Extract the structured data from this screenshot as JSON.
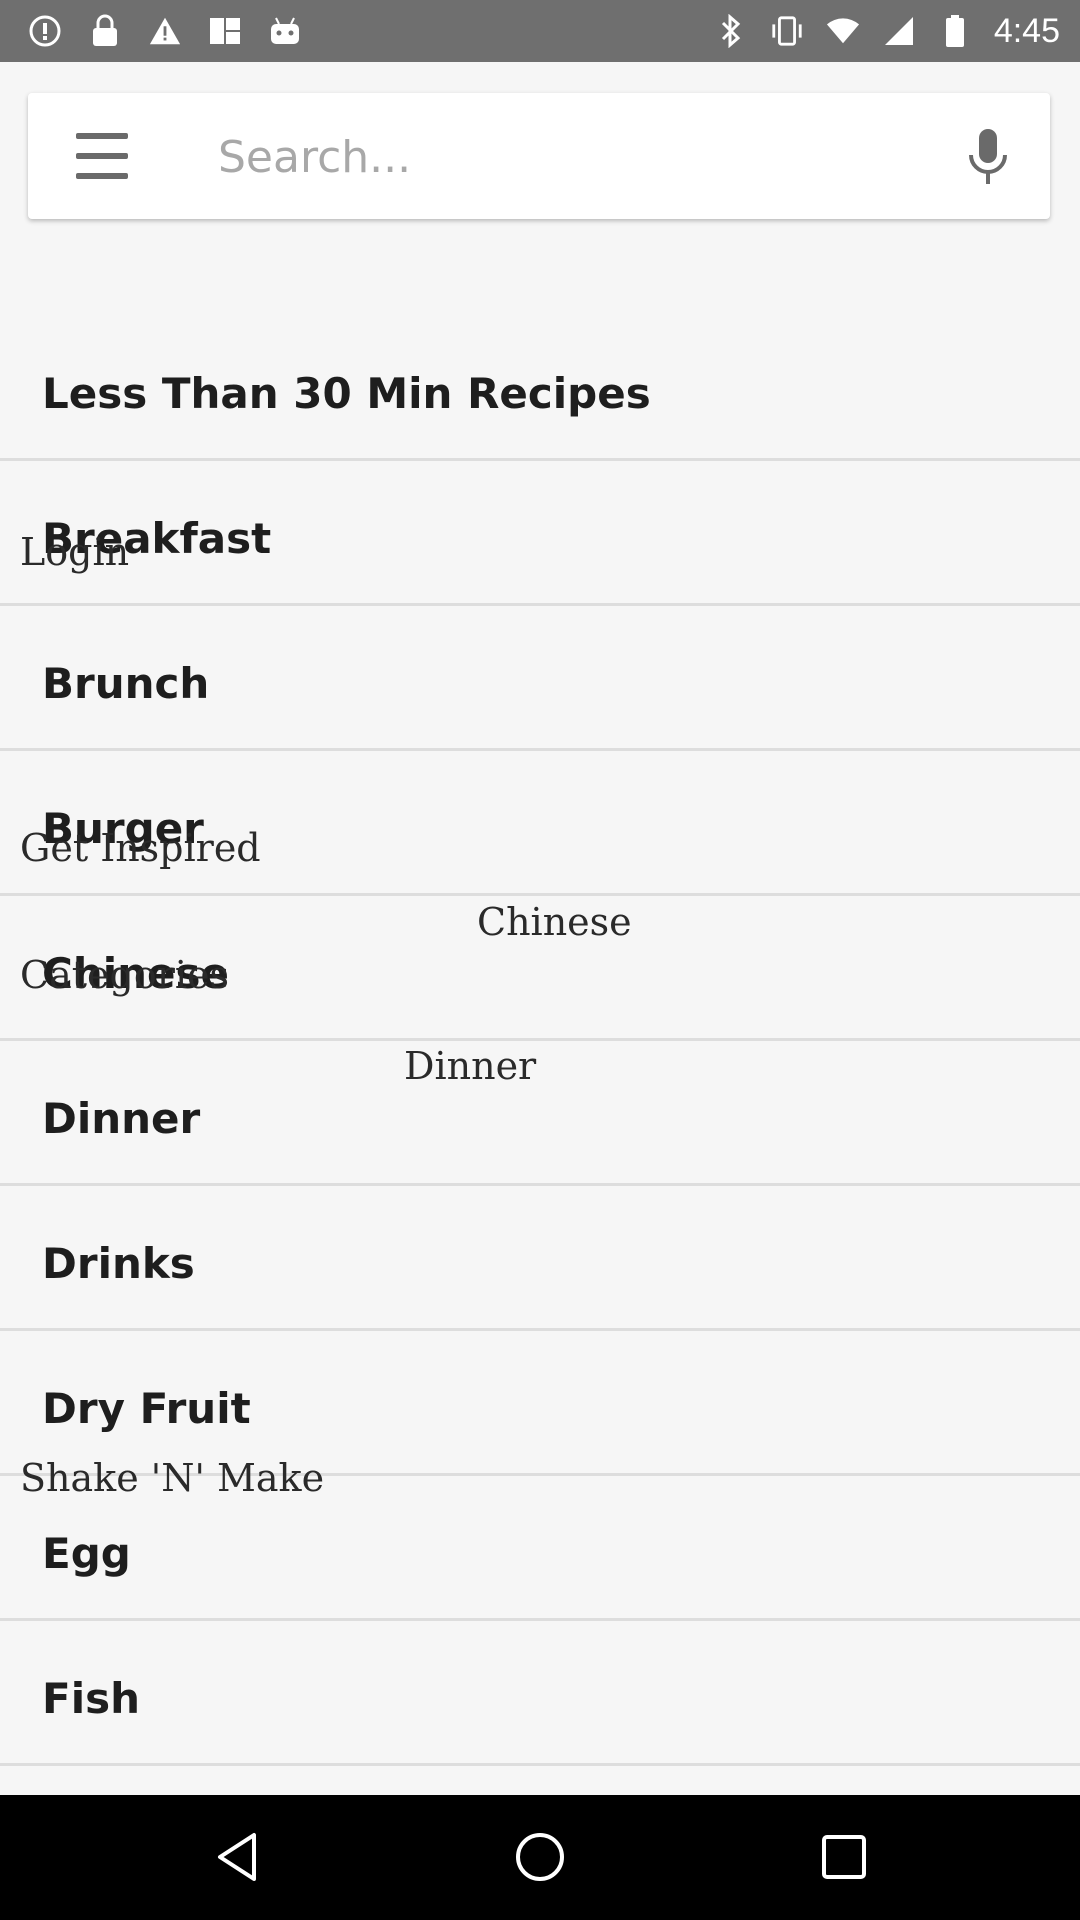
{
  "status_bar": {
    "time": "4:45",
    "left_icons": [
      "alert-circle-icon",
      "lock-icon",
      "warning-icon",
      "fake-gps-icon",
      "android-icon"
    ],
    "right_icons": [
      "bluetooth-icon",
      "vibrate-icon",
      "wifi-icon",
      "signal-icon",
      "battery-icon"
    ]
  },
  "search": {
    "placeholder": "Search..."
  },
  "list": {
    "items": [
      {
        "label": "Less Than 30 Min Recipes"
      },
      {
        "label": "Breakfast"
      },
      {
        "label": "Brunch"
      },
      {
        "label": "Burger"
      },
      {
        "label": "Chinese"
      },
      {
        "label": "Dinner"
      },
      {
        "label": "Drinks"
      },
      {
        "label": "Dry Fruit"
      },
      {
        "label": "Egg"
      },
      {
        "label": "Fish"
      }
    ]
  },
  "overlay": {
    "login": "Login",
    "get_inspired": "Get Inspired",
    "chinese": "Chinese",
    "categories": "Categories",
    "dinner": "Dinner",
    "shake_n_make": "Shake 'N' Make"
  },
  "colors": {
    "status_bar": "#6f6f6f",
    "background": "#f6f6f6",
    "divider": "#dddddd",
    "nav_bar": "#000000"
  }
}
